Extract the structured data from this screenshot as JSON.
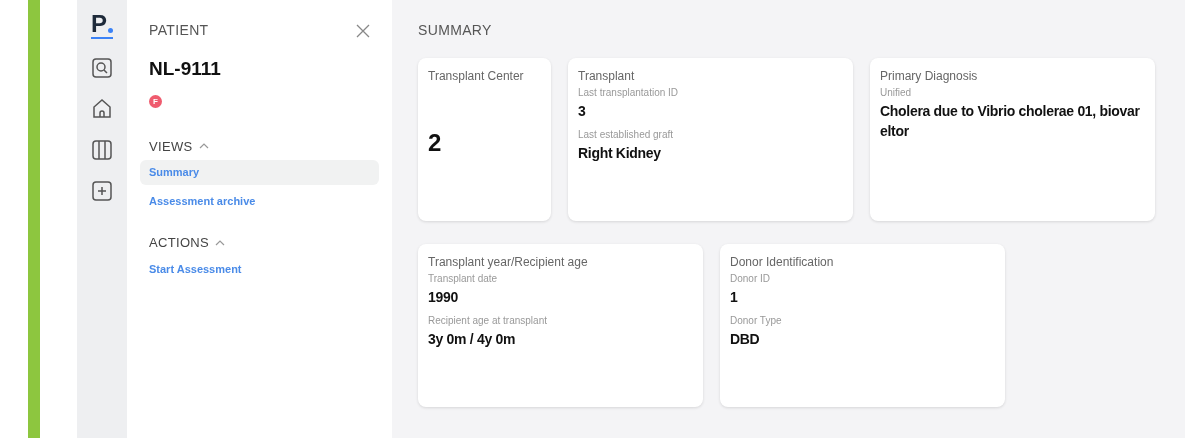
{
  "logo": "P",
  "rail": [
    {
      "kind": "search"
    },
    {
      "kind": "home"
    },
    {
      "kind": "columns"
    },
    {
      "kind": "add"
    }
  ],
  "panel": {
    "title": "PATIENT",
    "patient_id": "NL-9111",
    "badge": "F",
    "sections": [
      {
        "heading": "VIEWS",
        "expanded": true,
        "items": [
          {
            "label": "Summary",
            "selected": true
          },
          {
            "label": "Assessment archive",
            "selected": false
          }
        ]
      },
      {
        "heading": "ACTIONS",
        "expanded": true,
        "items": [
          {
            "label": "Start Assessment",
            "selected": false
          }
        ]
      }
    ]
  },
  "main": {
    "title": "SUMMARY",
    "rows": [
      [
        {
          "title": "Transplant Center",
          "kind": "big",
          "value": "2"
        },
        {
          "title": "Transplant",
          "kind": "fields",
          "fields": [
            {
              "label": "Last transplantation ID",
              "value": "3"
            },
            {
              "label": "Last established graft",
              "value": "Right Kidney"
            }
          ]
        },
        {
          "title": "Primary Diagnosis",
          "kind": "fields",
          "fields": [
            {
              "label": "Unified",
              "value": "Cholera due to Vibrio cholerae 01, biovar eltor"
            }
          ]
        }
      ],
      [
        {
          "title": "Transplant year/Recipient age",
          "kind": "fields",
          "fields": [
            {
              "label": "Transplant date",
              "value": "1990"
            },
            {
              "label": "Recipient age at transplant",
              "value": "3y 0m / 4y 0m"
            }
          ]
        },
        {
          "title": "Donor Identification",
          "kind": "fields",
          "fields": [
            {
              "label": "Donor ID",
              "value": "1"
            },
            {
              "label": "Donor Type",
              "value": "DBD"
            }
          ]
        }
      ]
    ]
  }
}
